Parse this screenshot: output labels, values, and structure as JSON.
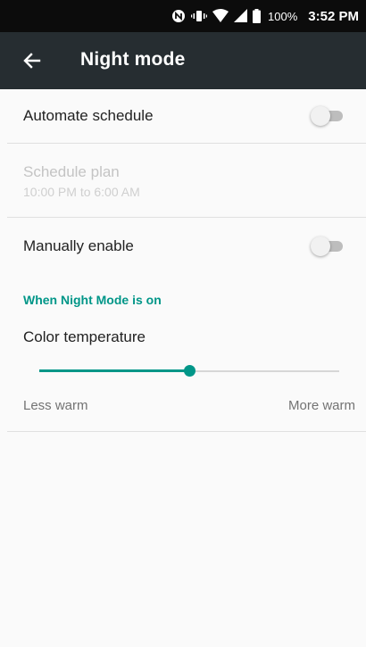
{
  "status_bar": {
    "icons": [
      "nfc-icon",
      "vibrate-icon",
      "wifi-icon",
      "signal-icon",
      "battery-icon"
    ],
    "battery_percent": "100%",
    "time": "3:52 PM"
  },
  "app_bar": {
    "back_icon": "arrow-left-icon",
    "title": "Night mode"
  },
  "settings": {
    "automate_schedule": {
      "label": "Automate schedule",
      "enabled": false
    },
    "schedule_plan": {
      "label": "Schedule plan",
      "summary": "10:00 PM to 6:00 AM",
      "disabled": true
    },
    "manually_enable": {
      "label": "Manually enable",
      "enabled": false
    },
    "section_header": "When Night Mode is on",
    "color_temperature": {
      "label": "Color temperature",
      "value_fraction": 0.5,
      "min_label": "Less warm",
      "max_label": "More warm"
    }
  },
  "colors": {
    "accent": "#009688",
    "app_bar": "#262d31",
    "status_bar": "#0c0c0c",
    "background": "#fafafa"
  }
}
